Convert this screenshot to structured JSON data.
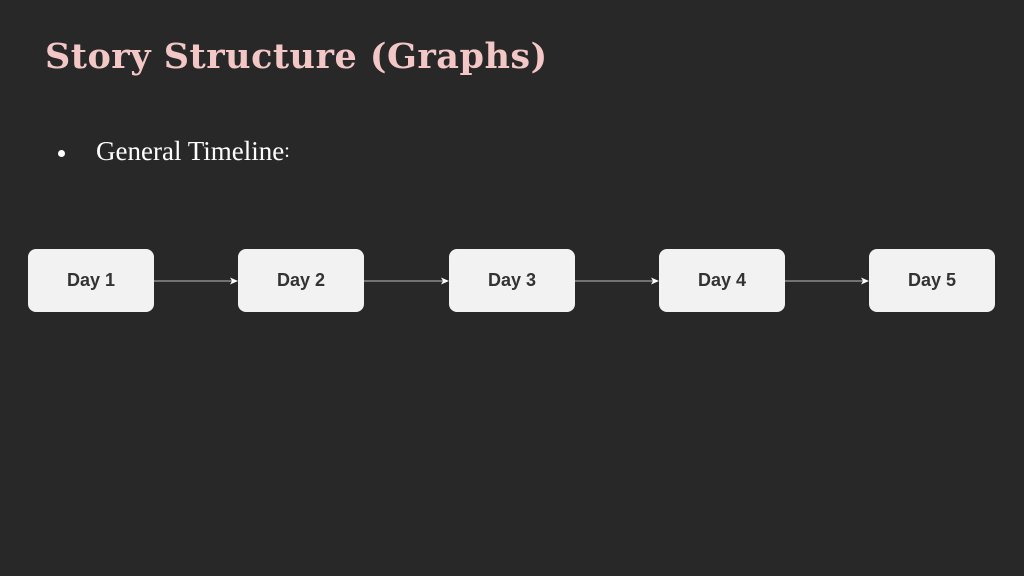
{
  "slide": {
    "title": "Story Structure (Graphs)",
    "bullets": [
      {
        "text": "General Timeline",
        "suffix": ":"
      }
    ]
  },
  "timeline": {
    "nodes": [
      "Day 1",
      "Day 2",
      "Day 3",
      "Day 4",
      "Day 5"
    ],
    "edges": [
      {
        "from": "Day 1",
        "to": "Day 2"
      },
      {
        "from": "Day 2",
        "to": "Day 3"
      },
      {
        "from": "Day 3",
        "to": "Day 4"
      },
      {
        "from": "Day 4",
        "to": "Day 5"
      }
    ]
  },
  "colors": {
    "background": "#282828",
    "title": "#f4c7c7",
    "text": "#ffffff",
    "node_fill": "#f2f2f2",
    "node_text": "#333333",
    "edge": "#bdbdbd"
  }
}
